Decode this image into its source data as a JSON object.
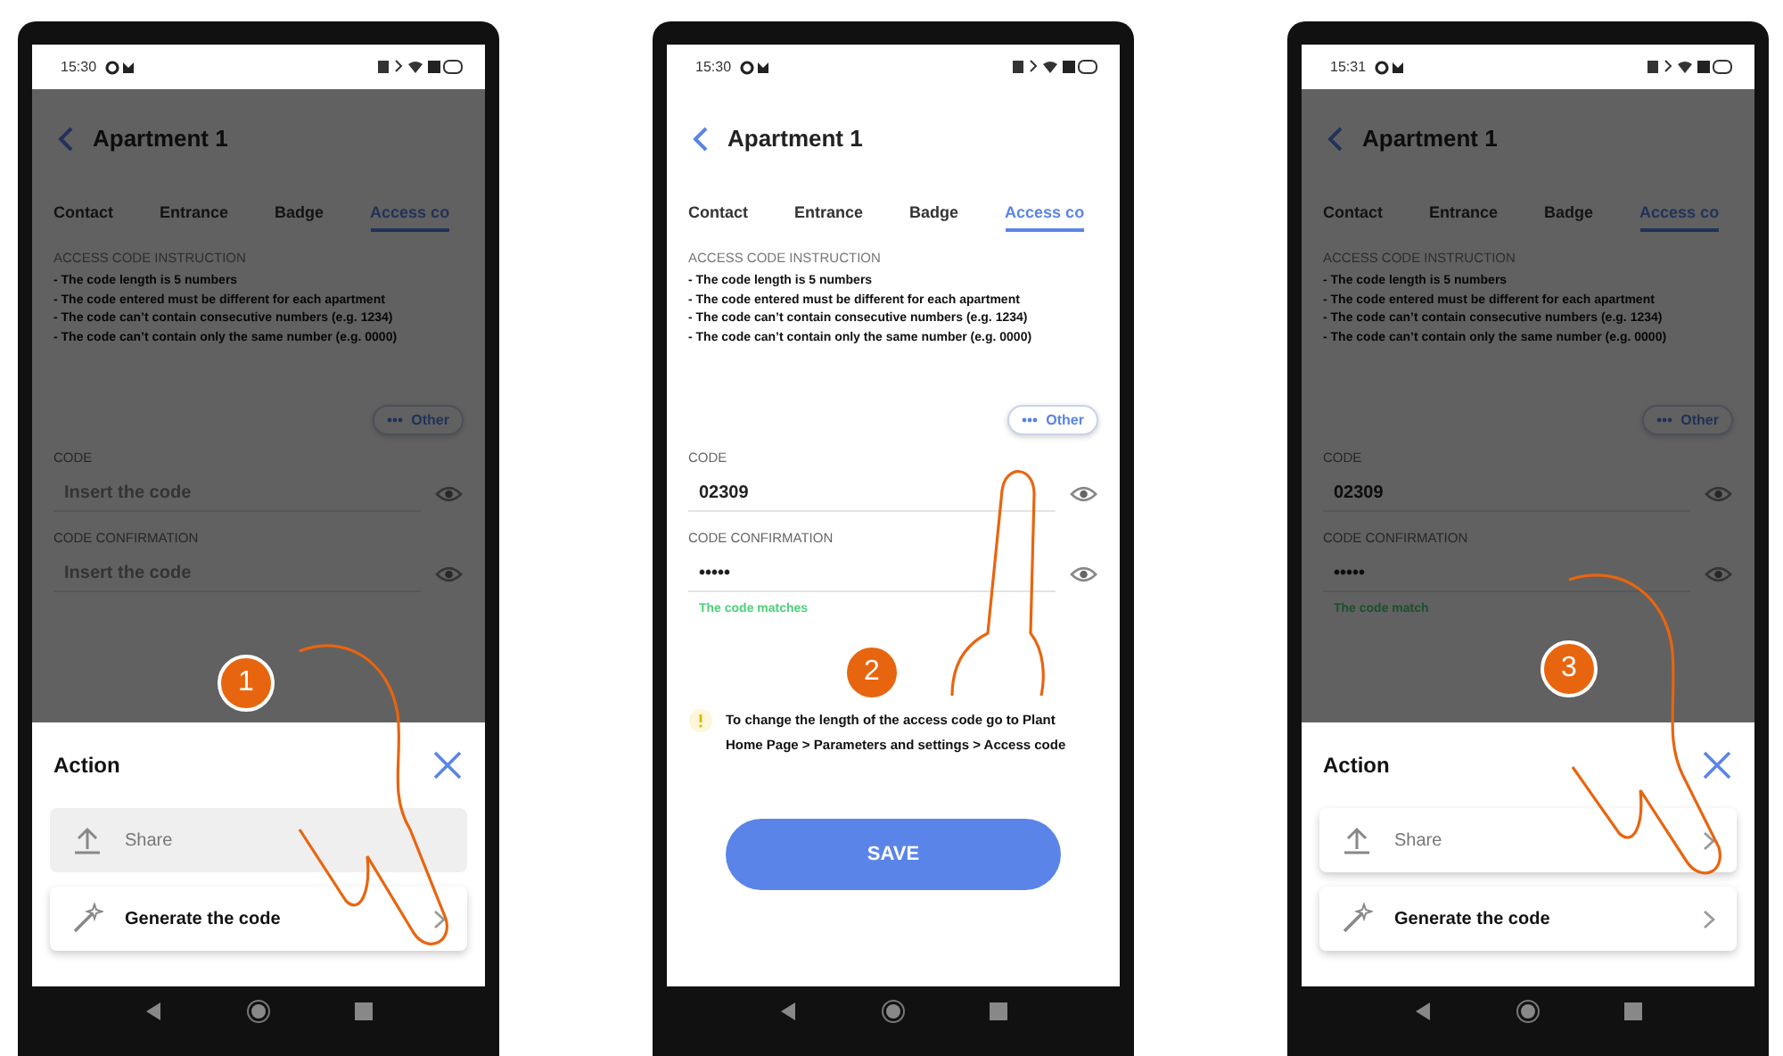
{
  "phones": [
    {
      "time": "15:30",
      "title": "Apartment 1",
      "tabs": [
        {
          "label": "Contact",
          "selected": false
        },
        {
          "label": "Entrance",
          "selected": false
        },
        {
          "label": "Badge",
          "selected": false
        },
        {
          "label": "Access co",
          "selected": true
        }
      ],
      "instruction_heading": "ACCESS CODE INSTRUCTION",
      "rules": [
        "- The code length is 5 numbers",
        "- The code entered must be different for each apartment",
        "- The code can’t contain consecutive numbers (e.g. 1234)",
        "- The code can’t contain only the same number (e.g. 0000)"
      ],
      "other_button": "Other",
      "fields": [
        {
          "label": "CODE",
          "placeholder": "Insert the code"
        },
        {
          "label": "CODE CONFIRMATION",
          "placeholder": "Insert the code"
        }
      ],
      "dimmed": true,
      "action_sheet": {
        "title": "Action",
        "items": [
          {
            "label": "Share",
            "kind": "share",
            "disabled": true
          },
          {
            "label": "Generate the code",
            "kind": "generate",
            "disabled": false
          }
        ]
      },
      "step": "1"
    },
    {
      "time": "15:30",
      "title": "Apartment 1",
      "tabs": [
        {
          "label": "Contact",
          "selected": false
        },
        {
          "label": "Entrance",
          "selected": false
        },
        {
          "label": "Badge",
          "selected": false
        },
        {
          "label": "Access co",
          "selected": true
        }
      ],
      "instruction_heading": "ACCESS CODE INSTRUCTION",
      "rules": [
        "- The code length is 5 numbers",
        "- The code entered must be different for each apartment",
        "- The code can’t contain consecutive numbers (e.g. 1234)",
        "- The code can’t contain only the same number (e.g. 0000)"
      ],
      "other_button": "Other",
      "fields": [
        {
          "label": "CODE",
          "value": "02309"
        },
        {
          "label": "CODE CONFIRMATION",
          "value": "•••••"
        }
      ],
      "match_message": "The code matches",
      "note": "To change the length of the access code go to Plant Home Page > Parameters and settings  > Access code",
      "save_button": "SAVE",
      "dimmed": false,
      "step": "2"
    },
    {
      "time": "15:31",
      "title": "Apartment 1",
      "tabs": [
        {
          "label": "Contact",
          "selected": false
        },
        {
          "label": "Entrance",
          "selected": false
        },
        {
          "label": "Badge",
          "selected": false
        },
        {
          "label": "Access co",
          "selected": true
        }
      ],
      "instruction_heading": "ACCESS CODE INSTRUCTION",
      "rules": [
        "- The code length is 5 numbers",
        "- The code entered must be different for each apartment",
        "- The code can’t contain consecutive numbers (e.g. 1234)",
        "- The code can’t contain only the same number (e.g. 0000)"
      ],
      "other_button": "Other",
      "fields": [
        {
          "label": "CODE",
          "value": "02309"
        },
        {
          "label": "CODE CONFIRMATION",
          "value": "•••••"
        }
      ],
      "match_message": "The code match",
      "dimmed": true,
      "action_sheet": {
        "title": "Action",
        "items": [
          {
            "label": "Share",
            "kind": "share",
            "disabled": false
          },
          {
            "label": "Generate the code",
            "kind": "generate",
            "disabled": false
          }
        ]
      },
      "step": "3"
    }
  ]
}
